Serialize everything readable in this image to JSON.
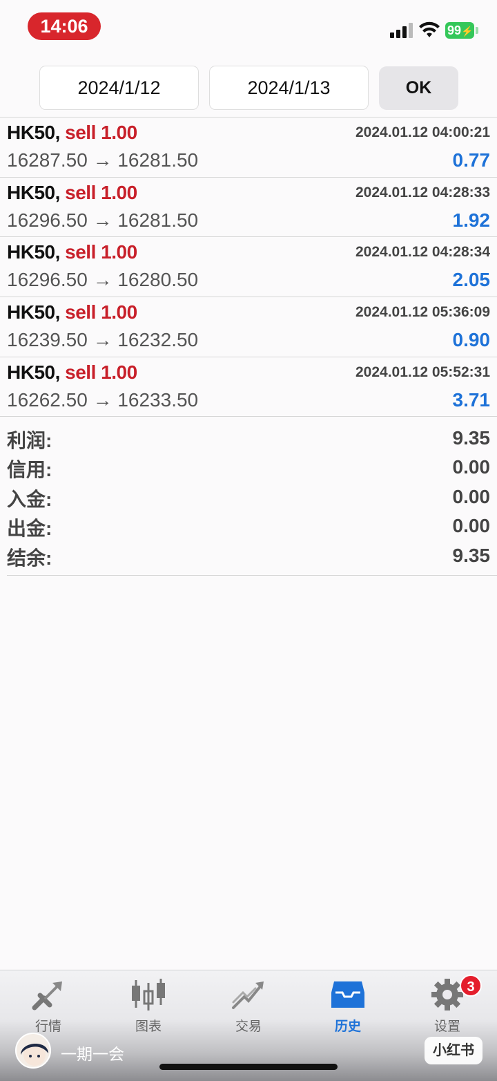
{
  "status_bar": {
    "time": "14:06",
    "battery": "99"
  },
  "filter": {
    "start_date": "2024/1/12",
    "end_date": "2024/1/13",
    "ok_label": "OK"
  },
  "deals": [
    {
      "symbol": "HK50,",
      "side": "sell 1.00",
      "time": "2024.01.12 04:00:21",
      "prices": "16287.50 → 16281.50",
      "profit": "0.77"
    },
    {
      "symbol": "HK50,",
      "side": "sell 1.00",
      "time": "2024.01.12 04:28:33",
      "prices": "16296.50 → 16281.50",
      "profit": "1.92"
    },
    {
      "symbol": "HK50,",
      "side": "sell 1.00",
      "time": "2024.01.12 04:28:34",
      "prices": "16296.50 → 16280.50",
      "profit": "2.05"
    },
    {
      "symbol": "HK50,",
      "side": "sell 1.00",
      "time": "2024.01.12 05:36:09",
      "prices": "16239.50 → 16232.50",
      "profit": "0.90"
    },
    {
      "symbol": "HK50,",
      "side": "sell 1.00",
      "time": "2024.01.12 05:52:31",
      "prices": "16262.50 → 16233.50",
      "profit": "3.71"
    }
  ],
  "summary": [
    {
      "label": "利润:",
      "value": "9.35"
    },
    {
      "label": "信用:",
      "value": "0.00"
    },
    {
      "label": "入金:",
      "value": "0.00"
    },
    {
      "label": "出金:",
      "value": "0.00"
    },
    {
      "label": "结余:",
      "value": "9.35"
    }
  ],
  "tabs": [
    {
      "label": "行情",
      "icon": "quotes-arrows-icon"
    },
    {
      "label": "图表",
      "icon": "candlestick-chart-icon"
    },
    {
      "label": "交易",
      "icon": "trade-trend-icon"
    },
    {
      "label": "历史",
      "icon": "history-inbox-icon",
      "active": true
    },
    {
      "label": "设置",
      "icon": "settings-gear-icon",
      "badge": "3"
    }
  ],
  "overlay": {
    "username": "一期一会",
    "watermark": "小红书"
  },
  "colors": {
    "sell": "#c8202a",
    "profit": "#1e72d8",
    "accent": "#1e72d8",
    "time_pill": "#d8262c",
    "battery": "#34c759"
  }
}
